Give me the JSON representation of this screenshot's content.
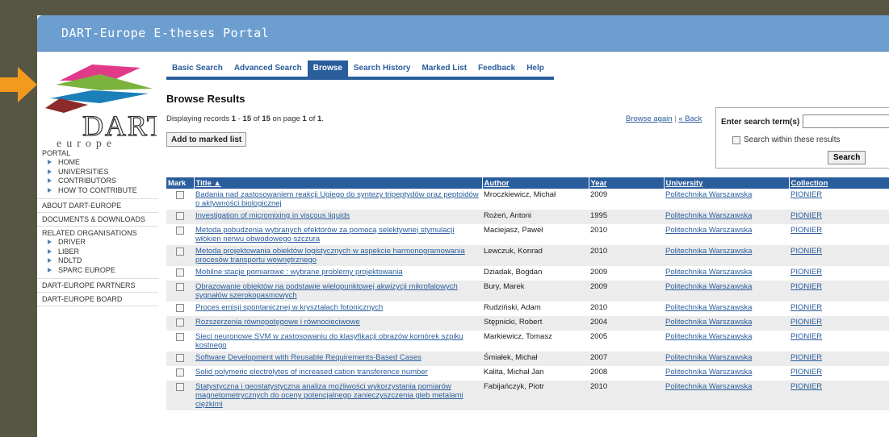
{
  "portal": {
    "title": "DART-Europe E-theses Portal"
  },
  "logo": {
    "text": "DART",
    "subtext": "europe"
  },
  "sidebar": {
    "sections": [
      {
        "label": "PORTAL",
        "items": [
          "HOME",
          "UNIVERSITIES",
          "CONTRIBUTORS",
          "HOW TO CONTRIBUTE"
        ]
      },
      {
        "label": "ABOUT DART-EUROPE",
        "items": []
      },
      {
        "label": "DOCUMENTS & DOWNLOADS",
        "items": []
      },
      {
        "label": "RELATED ORGANISATIONS",
        "items": [
          "DRIVER",
          "LIBER",
          "NDLTD",
          "SPARC EUROPE"
        ]
      },
      {
        "label": "DART-EUROPE PARTNERS",
        "items": []
      },
      {
        "label": "DART-EUROPE BOARD",
        "items": []
      }
    ]
  },
  "nav": {
    "tabs": [
      "Basic Search",
      "Advanced Search",
      "Browse",
      "Search History",
      "Marked List",
      "Feedback",
      "Help"
    ],
    "active": "Browse"
  },
  "browse": {
    "title": "Browse Results",
    "display_prefix": "Displaying records ",
    "start": "1",
    "dash": " - ",
    "end": "15",
    "of_text": " of ",
    "total": "15",
    "on_page": " on page ",
    "page": "1",
    "page_of": " of ",
    "pages": "1",
    "period": ".",
    "add_marked": "Add to marked list",
    "browse_again": "Browse again",
    "sep": " | ",
    "back": "« Back"
  },
  "search": {
    "label": "Enter search term(s)",
    "value": "",
    "within_label": "Search within these results",
    "button": "Search"
  },
  "table": {
    "headers": [
      "Mark",
      "Title ▲",
      "Author",
      "Year",
      "University",
      "Collection"
    ],
    "rows": [
      {
        "title": "Badania nad zastosowaniem reakcji Ugiego do syntezy tripeptydów oraz peptoidów o aktywności biologicznej",
        "author": "Mroczkiewicz, Michał",
        "year": "2009",
        "university": "Politechnika Warszawska",
        "collection": "PIONIER"
      },
      {
        "title": "Investigation of micromixing in viscous liquids",
        "author": "Rożeń, Antoni",
        "year": "1995",
        "university": "Politechnika Warszawska",
        "collection": "PIONIER"
      },
      {
        "title": "Metoda pobudzenia wybranych efektorów za pomocą selektywnej stymulacji włókien nerwu obwodowego szczura",
        "author": "Maciejasz, Paweł",
        "year": "2010",
        "university": "Politechnika Warszawska",
        "collection": "PIONIER"
      },
      {
        "title": "Metoda projektowania obiektów logistycznych w aspekcie harmonogramowania procesów transportu wewnętrznego",
        "author": "Lewczuk, Konrad",
        "year": "2010",
        "university": "Politechnika Warszawska",
        "collection": "PIONIER"
      },
      {
        "title": "Mobilne stacje pomiarowe : wybrane problemy projektowania",
        "author": "Dziadak, Bogdan",
        "year": "2009",
        "university": "Politechnika Warszawska",
        "collection": "PIONIER"
      },
      {
        "title": "Obrazowanie obiektów na podstawie wielopunktowej akwizycji mikrofalowych sygnałów szerokopasmowych",
        "author": "Bury, Marek",
        "year": "2009",
        "university": "Politechnika Warszawska",
        "collection": "PIONIER"
      },
      {
        "title": "Proces emisji spontanicznej w kryształach fotonicznych",
        "author": "Rudziński, Adam",
        "year": "2010",
        "university": "Politechnika Warszawska",
        "collection": "PIONIER"
      },
      {
        "title": "Rozszerzenia równopotęgowe i równocieciwowe",
        "author": "Stępnicki, Robert",
        "year": "2004",
        "university": "Politechnika Warszawska",
        "collection": "PIONIER"
      },
      {
        "title": "Sieci neuronowe SVM w zastosowaniu do klasyfikacji obrazów komórek szpiku kostnego",
        "author": "Markiewicz, Tomasz",
        "year": "2005",
        "university": "Politechnika Warszawska",
        "collection": "PIONIER"
      },
      {
        "title": "Software Development with Reusable Requirements-Based Cases",
        "author": "Śmiałek, Michał",
        "year": "2007",
        "university": "Politechnika Warszawska",
        "collection": "PIONIER"
      },
      {
        "title": "Solid polymeric electrolytes of increased cation transference number",
        "author": "Kalita, Michał Jan",
        "year": "2008",
        "university": "Politechnika Warszawska",
        "collection": "PIONIER"
      },
      {
        "title": "Statystyczna i geostatystyczna analiza możliwości wykorzystania pomiarów magnetometrycznych do oceny potencjalnego zanieczyszczenia gleb metalami ciężkimi",
        "author": "Fabijańczyk, Piotr",
        "year": "2010",
        "university": "Politechnika Warszawska",
        "collection": "PIONIER"
      }
    ]
  },
  "colors": {
    "header_blue": "#6c9ed0",
    "nav_blue": "#2a5d9c",
    "arrow_orange": "#f39a1e",
    "background": "#575645"
  }
}
